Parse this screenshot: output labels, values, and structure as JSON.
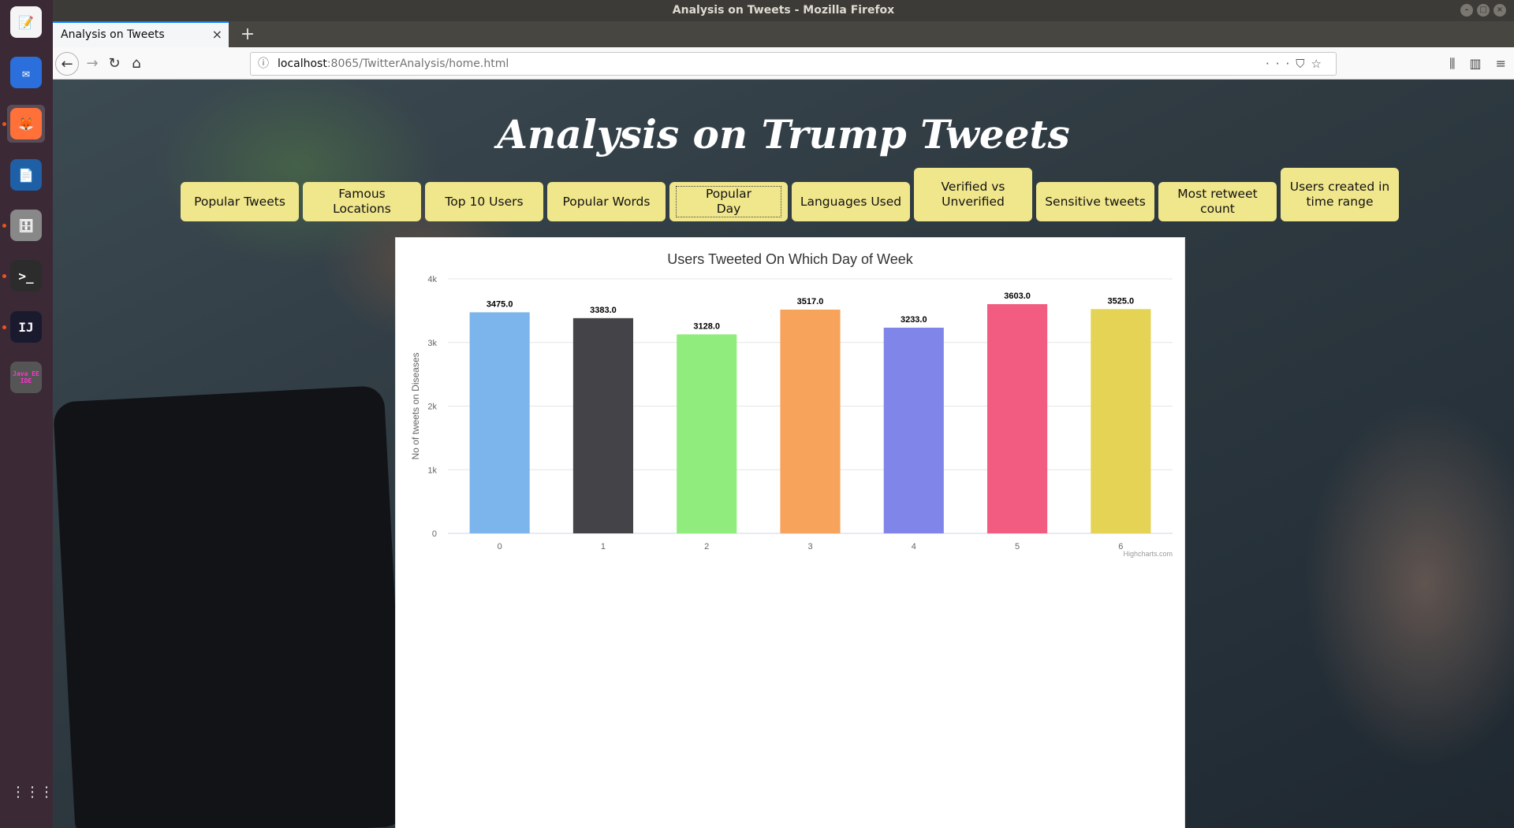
{
  "window": {
    "title": "Analysis on Tweets - Mozilla Firefox"
  },
  "dock": {
    "items": [
      {
        "name": "text-editor-icon",
        "glyph": "📝"
      },
      {
        "name": "thunderbird-icon",
        "glyph": "✉"
      },
      {
        "name": "firefox-icon",
        "glyph": "🦊"
      },
      {
        "name": "libreoffice-writer-icon",
        "glyph": "📄"
      },
      {
        "name": "files-icon",
        "glyph": "🗄"
      },
      {
        "name": "terminal-icon",
        "glyph": ">_"
      },
      {
        "name": "intellij-icon",
        "glyph": "IJ"
      },
      {
        "name": "java-ee-ide-icon",
        "glyph": "Java EE IDE"
      }
    ],
    "apps_grid_glyph": "⋮⋮⋮"
  },
  "tab": {
    "label": "Analysis on Tweets",
    "close": "×"
  },
  "newtab": "+",
  "url": {
    "host": "localhost",
    "rest": ":8065/TwitterAnalysis/home.html"
  },
  "page": {
    "title": "Analysis on Trump Tweets",
    "buttons": [
      "Popular Tweets",
      "Famous Locations",
      "Top 10 Users",
      "Popular Words",
      "Popular Day",
      "Languages Used",
      "Verified vs Unverified",
      "Sensitive tweets",
      "Most retweet count",
      "Users created in time range"
    ],
    "selected_button": "Popular Day"
  },
  "chart_data": {
    "type": "bar",
    "title": "Users Tweeted On Which Day of Week",
    "xlabel": "",
    "ylabel": "No of tweets on Diseases",
    "categories": [
      "0",
      "1",
      "2",
      "3",
      "4",
      "5",
      "6"
    ],
    "values": [
      3475.0,
      3383.0,
      3128.0,
      3517.0,
      3233.0,
      3603.0,
      3525.0
    ],
    "data_labels": [
      "3475.0",
      "3383.0",
      "3128.0",
      "3517.0",
      "3233.0",
      "3603.0",
      "3525.0"
    ],
    "colors": [
      "#7cb5ec",
      "#434348",
      "#90ed7d",
      "#f7a35c",
      "#8085e9",
      "#f15c80",
      "#e4d354"
    ],
    "ylim": [
      0,
      4000
    ],
    "yticks": [
      0,
      1000,
      2000,
      3000,
      4000
    ],
    "ytick_labels": [
      "0",
      "1k",
      "2k",
      "3k",
      "4k"
    ],
    "grid": true,
    "credits": "Highcharts.com"
  }
}
